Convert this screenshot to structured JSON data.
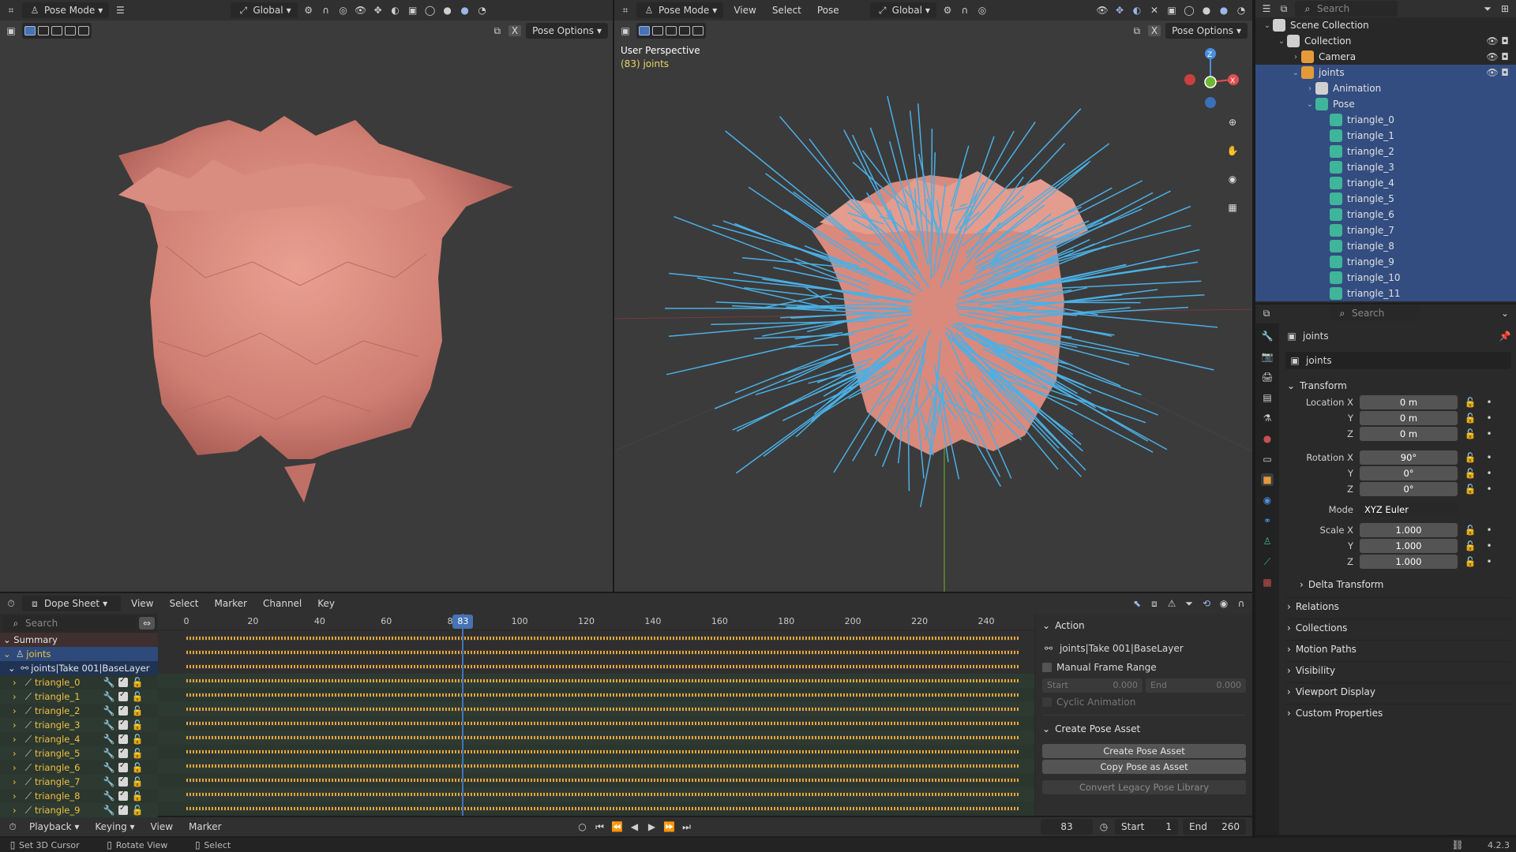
{
  "left_view": {
    "header": {
      "mode": "Pose Mode",
      "orientation": "Global",
      "options": "Pose Options"
    }
  },
  "right_view": {
    "header": {
      "mode": "Pose Mode",
      "menus": [
        "View",
        "Select",
        "Pose"
      ],
      "orientation": "Global",
      "options": "Pose Options"
    },
    "overlay": {
      "perspective": "User Perspective",
      "object": "(83) joints"
    },
    "gizmo": {
      "z": "Z",
      "x": "X"
    }
  },
  "outliner": {
    "search_placeholder": "Search",
    "rows": [
      {
        "label": "Scene Collection",
        "depth": 0,
        "icon_color": "#cfcfcf"
      },
      {
        "label": "Collection",
        "depth": 1,
        "icon_color": "#cfcfcf"
      },
      {
        "label": "Camera",
        "depth": 2,
        "icon_color": "#e59a3a"
      },
      {
        "label": "joints",
        "depth": 2,
        "icon_color": "#e59a3a"
      },
      {
        "label": "Animation",
        "depth": 3,
        "icon_color": "#cfcfcf"
      },
      {
        "label": "Pose",
        "depth": 3,
        "icon_color": "#3fb59a"
      },
      {
        "label": "triangle_0",
        "depth": 4,
        "icon_color": "#3fb59a"
      },
      {
        "label": "triangle_1",
        "depth": 4,
        "icon_color": "#3fb59a"
      },
      {
        "label": "triangle_2",
        "depth": 4,
        "icon_color": "#3fb59a"
      },
      {
        "label": "triangle_3",
        "depth": 4,
        "icon_color": "#3fb59a"
      },
      {
        "label": "triangle_4",
        "depth": 4,
        "icon_color": "#3fb59a"
      },
      {
        "label": "triangle_5",
        "depth": 4,
        "icon_color": "#3fb59a"
      },
      {
        "label": "triangle_6",
        "depth": 4,
        "icon_color": "#3fb59a"
      },
      {
        "label": "triangle_7",
        "depth": 4,
        "icon_color": "#3fb59a"
      },
      {
        "label": "triangle_8",
        "depth": 4,
        "icon_color": "#3fb59a"
      },
      {
        "label": "triangle_9",
        "depth": 4,
        "icon_color": "#3fb59a"
      },
      {
        "label": "triangle_10",
        "depth": 4,
        "icon_color": "#3fb59a"
      },
      {
        "label": "triangle_11",
        "depth": 4,
        "icon_color": "#3fb59a"
      }
    ]
  },
  "properties": {
    "search_placeholder": "Search",
    "object_name": "joints",
    "object_field": "joints",
    "transform_title": "Transform",
    "location_label": "Location X",
    "location": [
      "0 m",
      "0 m",
      "0 m"
    ],
    "rotation_label": "Rotation X",
    "rotation": [
      "90°",
      "0°",
      "0°"
    ],
    "axis_y": "Y",
    "axis_z": "Z",
    "mode_label": "Mode",
    "mode_value": "XYZ Euler",
    "scale_label": "Scale X",
    "scale": [
      "1.000",
      "1.000",
      "1.000"
    ],
    "delta_transform": "Delta Transform",
    "sections": [
      "Relations",
      "Collections",
      "Motion Paths",
      "Visibility",
      "Viewport Display",
      "Custom Properties"
    ]
  },
  "dopesheet": {
    "editor": "Dope Sheet",
    "menus": [
      "View",
      "Select",
      "Marker",
      "Channel",
      "Key"
    ],
    "search_placeholder": "Search",
    "ticks": [
      "0",
      "20",
      "40",
      "60",
      "80",
      "100",
      "120",
      "140",
      "160",
      "180",
      "200",
      "220",
      "240"
    ],
    "current_frame": "83",
    "summary": "Summary",
    "object": "joints",
    "action_row": "joints|Take 001|BaseLayer",
    "channels": [
      "triangle_0",
      "triangle_1",
      "triangle_2",
      "triangle_3",
      "triangle_4",
      "triangle_5",
      "triangle_6",
      "triangle_7",
      "triangle_8",
      "triangle_9"
    ]
  },
  "action_panel": {
    "title": "Action",
    "action_name": "joints|Take 001|BaseLayer",
    "manual_frame_range": "Manual Frame Range",
    "start_label": "Start",
    "start_value": "0.000",
    "end_label": "End",
    "end_value": "0.000",
    "cyclic": "Cyclic Animation",
    "pose_asset_title": "Create Pose Asset",
    "create_pose_asset": "Create Pose Asset",
    "copy_pose_asset": "Copy Pose as Asset",
    "convert_legacy": "Convert Legacy Pose Library"
  },
  "timeline": {
    "menus": [
      "Playback",
      "Keying",
      "View",
      "Marker"
    ],
    "frame": "83",
    "start_label": "Start",
    "start": "1",
    "end_label": "End",
    "end": "260"
  },
  "statusbar": {
    "items": [
      "Set 3D Cursor",
      "Rotate View",
      "Select"
    ],
    "version": "4.2.3"
  }
}
